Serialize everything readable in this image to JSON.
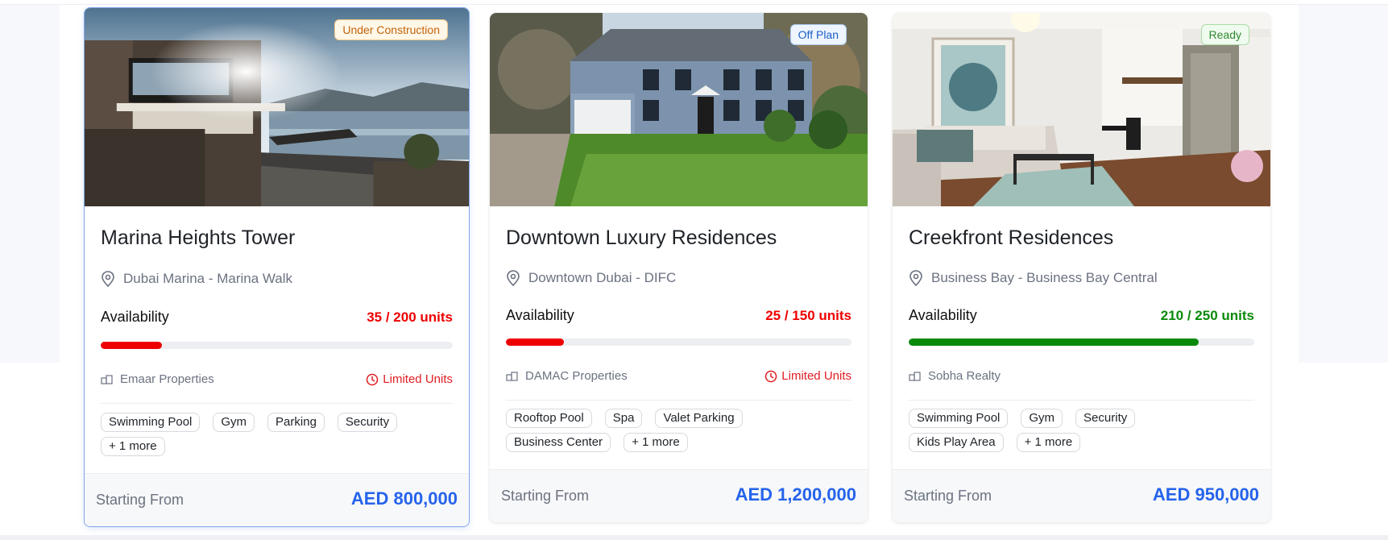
{
  "cards": [
    {
      "title": "Marina Heights Tower",
      "badge": "Under Construction",
      "location": "Dubai Marina - Marina Walk",
      "availability_label": "Availability",
      "availability_text": "35 / 200 units",
      "availability_fraction": 0.175,
      "availability_color": "#ef0000",
      "developer": "Emaar Properties",
      "limited_label": "Limited Units",
      "tags": [
        "Swimming Pool",
        "Gym",
        "Parking",
        "Security",
        "+ 1 more"
      ],
      "starting_label": "Starting From",
      "price": "AED 800,000",
      "selected": true
    },
    {
      "title": "Downtown Luxury Residences",
      "badge": "Off Plan",
      "location": "Downtown Dubai - DIFC",
      "availability_label": "Availability",
      "availability_text": "25 / 150 units",
      "availability_fraction": 0.167,
      "availability_color": "#ef0000",
      "developer": "DAMAC Properties",
      "limited_label": "Limited Units",
      "tags": [
        "Rooftop Pool",
        "Spa",
        "Valet Parking",
        "Business Center",
        "+ 1 more"
      ],
      "starting_label": "Starting From",
      "price": "AED 1,200,000",
      "selected": false
    },
    {
      "title": "Creekfront Residences",
      "badge": "Ready",
      "location": "Business Bay - Business Bay Central",
      "availability_label": "Availability",
      "availability_text": "210 / 250 units",
      "availability_fraction": 0.84,
      "availability_color": "#0a8a0a",
      "developer": "Sobha Realty",
      "limited_label": "",
      "tags": [
        "Swimming Pool",
        "Gym",
        "Security",
        "Kids Play Area",
        "+ 1 more"
      ],
      "starting_label": "Starting From",
      "price": "AED 950,000",
      "selected": false
    }
  ],
  "badge_styles": {
    "Under Construction": {
      "color": "#c2620a",
      "bg": "#fff7e8",
      "border": "#f3c98a"
    },
    "Off Plan": {
      "color": "#1d5fc2",
      "bg": "#eef5ff",
      "border": "#a8c8f0"
    },
    "Ready": {
      "color": "#2f8a2f",
      "bg": "#f0fbef",
      "border": "#a9dca6"
    }
  },
  "icons": {
    "location": "map-pin-icon",
    "developer": "building-icon",
    "limited": "clock-icon"
  }
}
